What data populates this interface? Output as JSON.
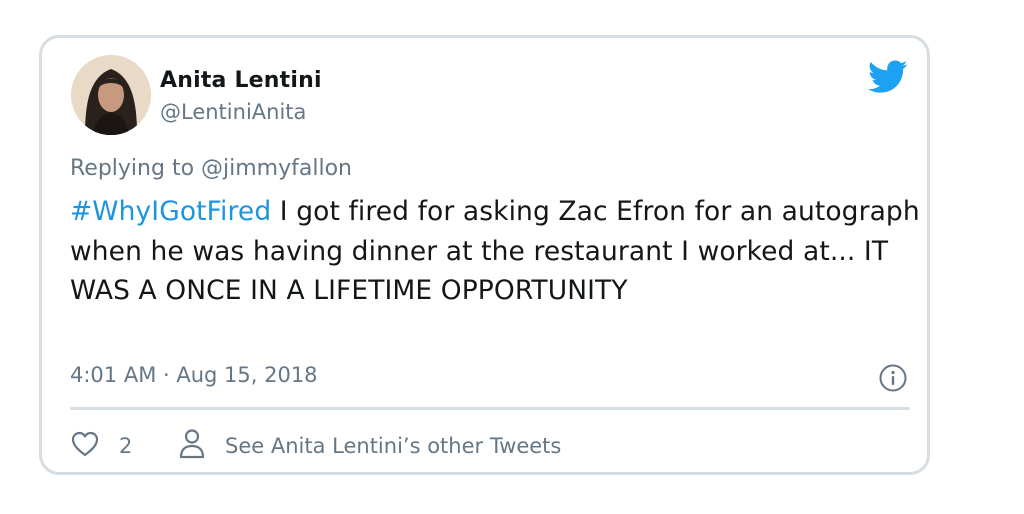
{
  "author": {
    "name": "Anita Lentini",
    "handle": "@LentiniAnita"
  },
  "reply": {
    "prefix": "Replying to",
    "to": "@jimmyfallon"
  },
  "tweet": {
    "hashtag": "#WhyIGotFired",
    "text": " I got fired for asking Zac Efron for an autograph when he was having dinner at the restaurant I worked at... IT WAS A ONCE IN A LIFETIME OPPORTUNITY"
  },
  "meta": {
    "timestamp": "4:01 AM · Aug 15, 2018"
  },
  "actions": {
    "like_count": "2",
    "other_tweets_label": "See Anita Lentini’s other Tweets"
  },
  "icons": {
    "brand": "twitter-bird-icon",
    "info": "info-icon",
    "like": "heart-icon",
    "profile": "person-icon"
  },
  "colors": {
    "brand": "#1da1f2",
    "hashtag": "#1b95e0",
    "secondary_text": "#657786",
    "primary_text": "#14171a",
    "border": "#d6dde3"
  }
}
